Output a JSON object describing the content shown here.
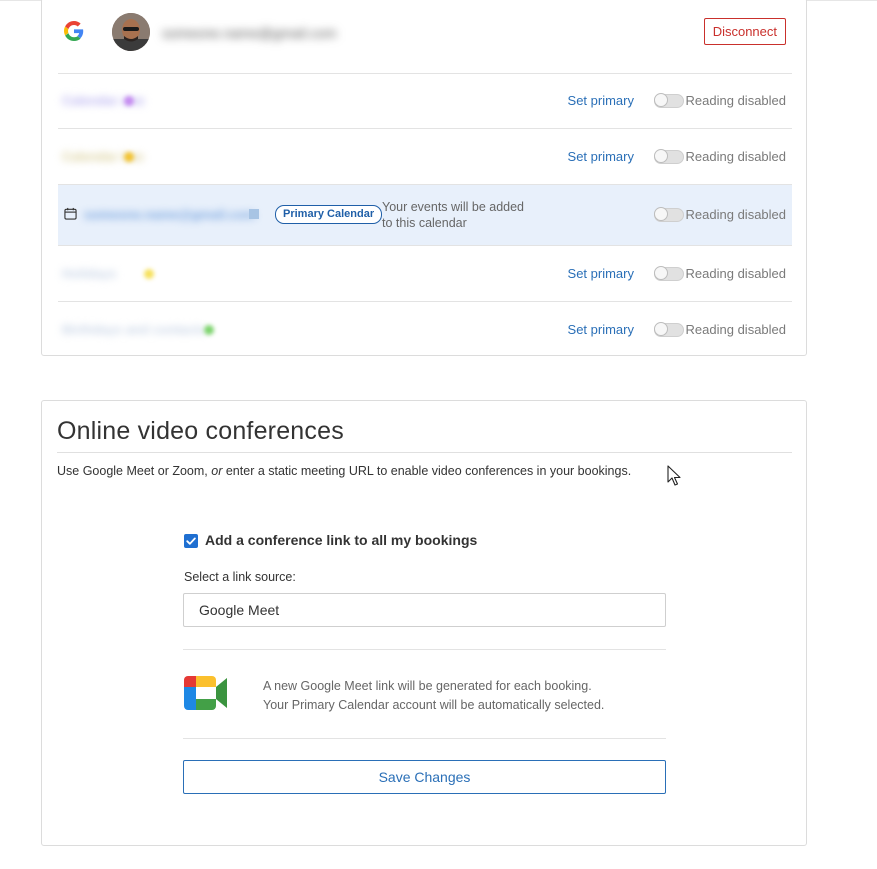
{
  "account": {
    "provider_icon": "google-icon",
    "email_blurred": "someone.name@gmail.com",
    "disconnect_label": "Disconnect"
  },
  "calendars": [
    {
      "name_blurred": "Calendar one",
      "dot_color": "#c58bf0",
      "set_primary_label": "Set primary",
      "reading_status": "Reading disabled"
    },
    {
      "name_blurred": "Calendar two",
      "dot_color": "#f2c230",
      "set_primary_label": "Set primary",
      "reading_status": "Reading disabled"
    },
    {
      "name_blurred": "someone.name@gmail.com",
      "is_primary": true,
      "badge": "Primary Calendar",
      "note": "Your events will be added to this calendar",
      "reading_status": "Reading disabled"
    },
    {
      "name_blurred": "Holidays",
      "dot_color": "#f6e05a",
      "set_primary_label": "Set primary",
      "reading_status": "Reading disabled"
    },
    {
      "name_blurred": "Birthdays and contacts",
      "dot_color": "#7bd36b",
      "set_primary_label": "Set primary",
      "reading_status": "Reading disabled"
    }
  ],
  "conference": {
    "title": "Online video conferences",
    "description_pre": "Use Google Meet or Zoom,",
    "description_or": "or",
    "description_post": "enter a static meeting URL to enable video conferences in your bookings.",
    "checkbox_label": "Add a conference link to all my bookings",
    "checkbox_checked": true,
    "source_label": "Select a link source:",
    "source_value": "Google Meet",
    "meet_note_line1": "A new Google Meet link will be generated for each booking.",
    "meet_note_line2": "Your Primary Calendar account will be automatically selected.",
    "save_label": "Save Changes"
  },
  "colors": {
    "link_blue": "#2a6fb7",
    "danger_red": "#c9302c",
    "primary_row_bg": "#e8f0fb",
    "checkbox_blue": "#1f6fd1"
  }
}
